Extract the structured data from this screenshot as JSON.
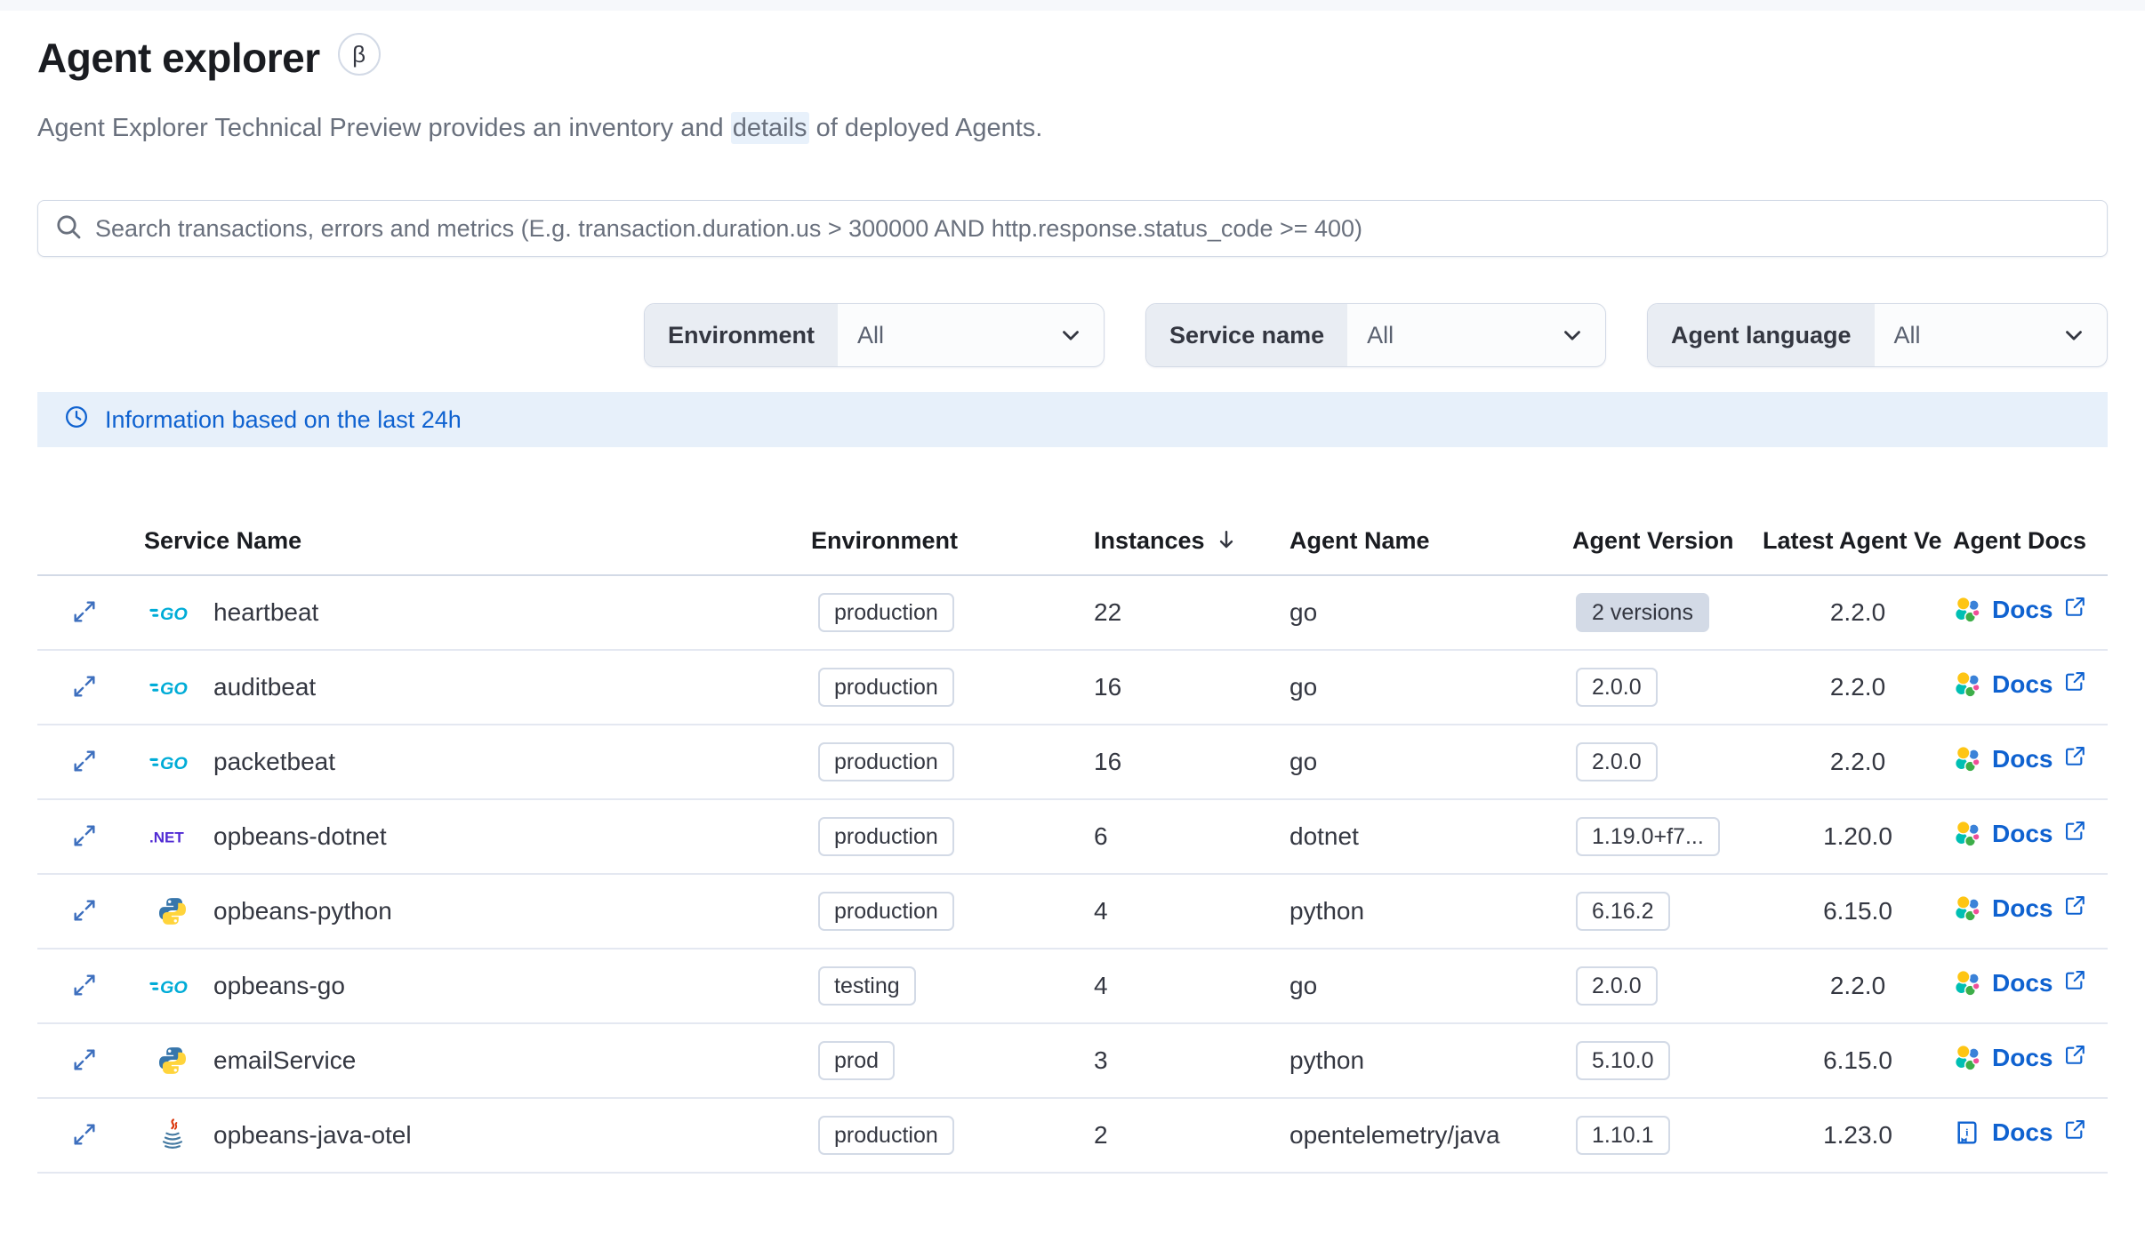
{
  "page": {
    "title": "Agent explorer",
    "beta": "β",
    "subtitle": {
      "before": "Agent Explorer Technical Preview provides an inventory and ",
      "highlight": "details",
      "after": " of deployed Agents."
    }
  },
  "search": {
    "placeholder": "Search transactions, errors and metrics (E.g. transaction.duration.us > 300000 AND http.response.status_code >= 400)"
  },
  "filters": [
    {
      "label": "Environment",
      "value": "All"
    },
    {
      "label": "Service name",
      "value": "All"
    },
    {
      "label": "Agent language",
      "value": "All"
    }
  ],
  "banner": {
    "text": "Information based on the last 24h"
  },
  "table": {
    "columns": [
      "Service Name",
      "Environment",
      "Instances",
      "Agent Name",
      "Agent Version",
      "Latest Agent Ve",
      "Agent Docs"
    ],
    "sorted_column": "Instances",
    "sort_direction": "desc",
    "rows": [
      {
        "service": "heartbeat",
        "icon": "go",
        "environment": "production",
        "instances": "22",
        "agent_name": "go",
        "agent_version": "2 versions",
        "version_style": "filled",
        "latest_version": "2.2.0",
        "docs_label": "Docs",
        "docs_icon": "elastic"
      },
      {
        "service": "auditbeat",
        "icon": "go",
        "environment": "production",
        "instances": "16",
        "agent_name": "go",
        "agent_version": "2.0.0",
        "version_style": "hollow",
        "latest_version": "2.2.0",
        "docs_label": "Docs",
        "docs_icon": "elastic"
      },
      {
        "service": "packetbeat",
        "icon": "go",
        "environment": "production",
        "instances": "16",
        "agent_name": "go",
        "agent_version": "2.0.0",
        "version_style": "hollow",
        "latest_version": "2.2.0",
        "docs_label": "Docs",
        "docs_icon": "elastic"
      },
      {
        "service": "opbeans-dotnet",
        "icon": "dotnet",
        "environment": "production",
        "instances": "6",
        "agent_name": "dotnet",
        "agent_version": "1.19.0+f7...",
        "version_style": "hollow",
        "latest_version": "1.20.0",
        "docs_label": "Docs",
        "docs_icon": "elastic"
      },
      {
        "service": "opbeans-python",
        "icon": "python",
        "environment": "production",
        "instances": "4",
        "agent_name": "python",
        "agent_version": "6.16.2",
        "version_style": "hollow",
        "latest_version": "6.15.0",
        "docs_label": "Docs",
        "docs_icon": "elastic"
      },
      {
        "service": "opbeans-go",
        "icon": "go",
        "environment": "testing",
        "instances": "4",
        "agent_name": "go",
        "agent_version": "2.0.0",
        "version_style": "hollow",
        "latest_version": "2.2.0",
        "docs_label": "Docs",
        "docs_icon": "elastic"
      },
      {
        "service": "emailService",
        "icon": "python",
        "environment": "prod",
        "instances": "3",
        "agent_name": "python",
        "agent_version": "5.10.0",
        "version_style": "hollow",
        "latest_version": "6.15.0",
        "docs_label": "Docs",
        "docs_icon": "elastic"
      },
      {
        "service": "opbeans-java-otel",
        "icon": "java",
        "environment": "production",
        "instances": "2",
        "agent_name": "opentelemetry/java",
        "agent_version": "1.10.1",
        "version_style": "hollow",
        "latest_version": "1.23.0",
        "docs_label": "Docs",
        "docs_icon": "book"
      }
    ]
  },
  "colors": {
    "accent_blue": "#0f62d0",
    "banner_bg": "#e7f0fa",
    "highlight_bg": "#e8f1fb",
    "badge_border": "#d3dae6",
    "badge_filled_bg": "#d3dae6",
    "text_dark": "#343741",
    "text_gray": "#69707d",
    "go_icon": "#00ACD7",
    "dotnet_icon": "#512BD4"
  }
}
